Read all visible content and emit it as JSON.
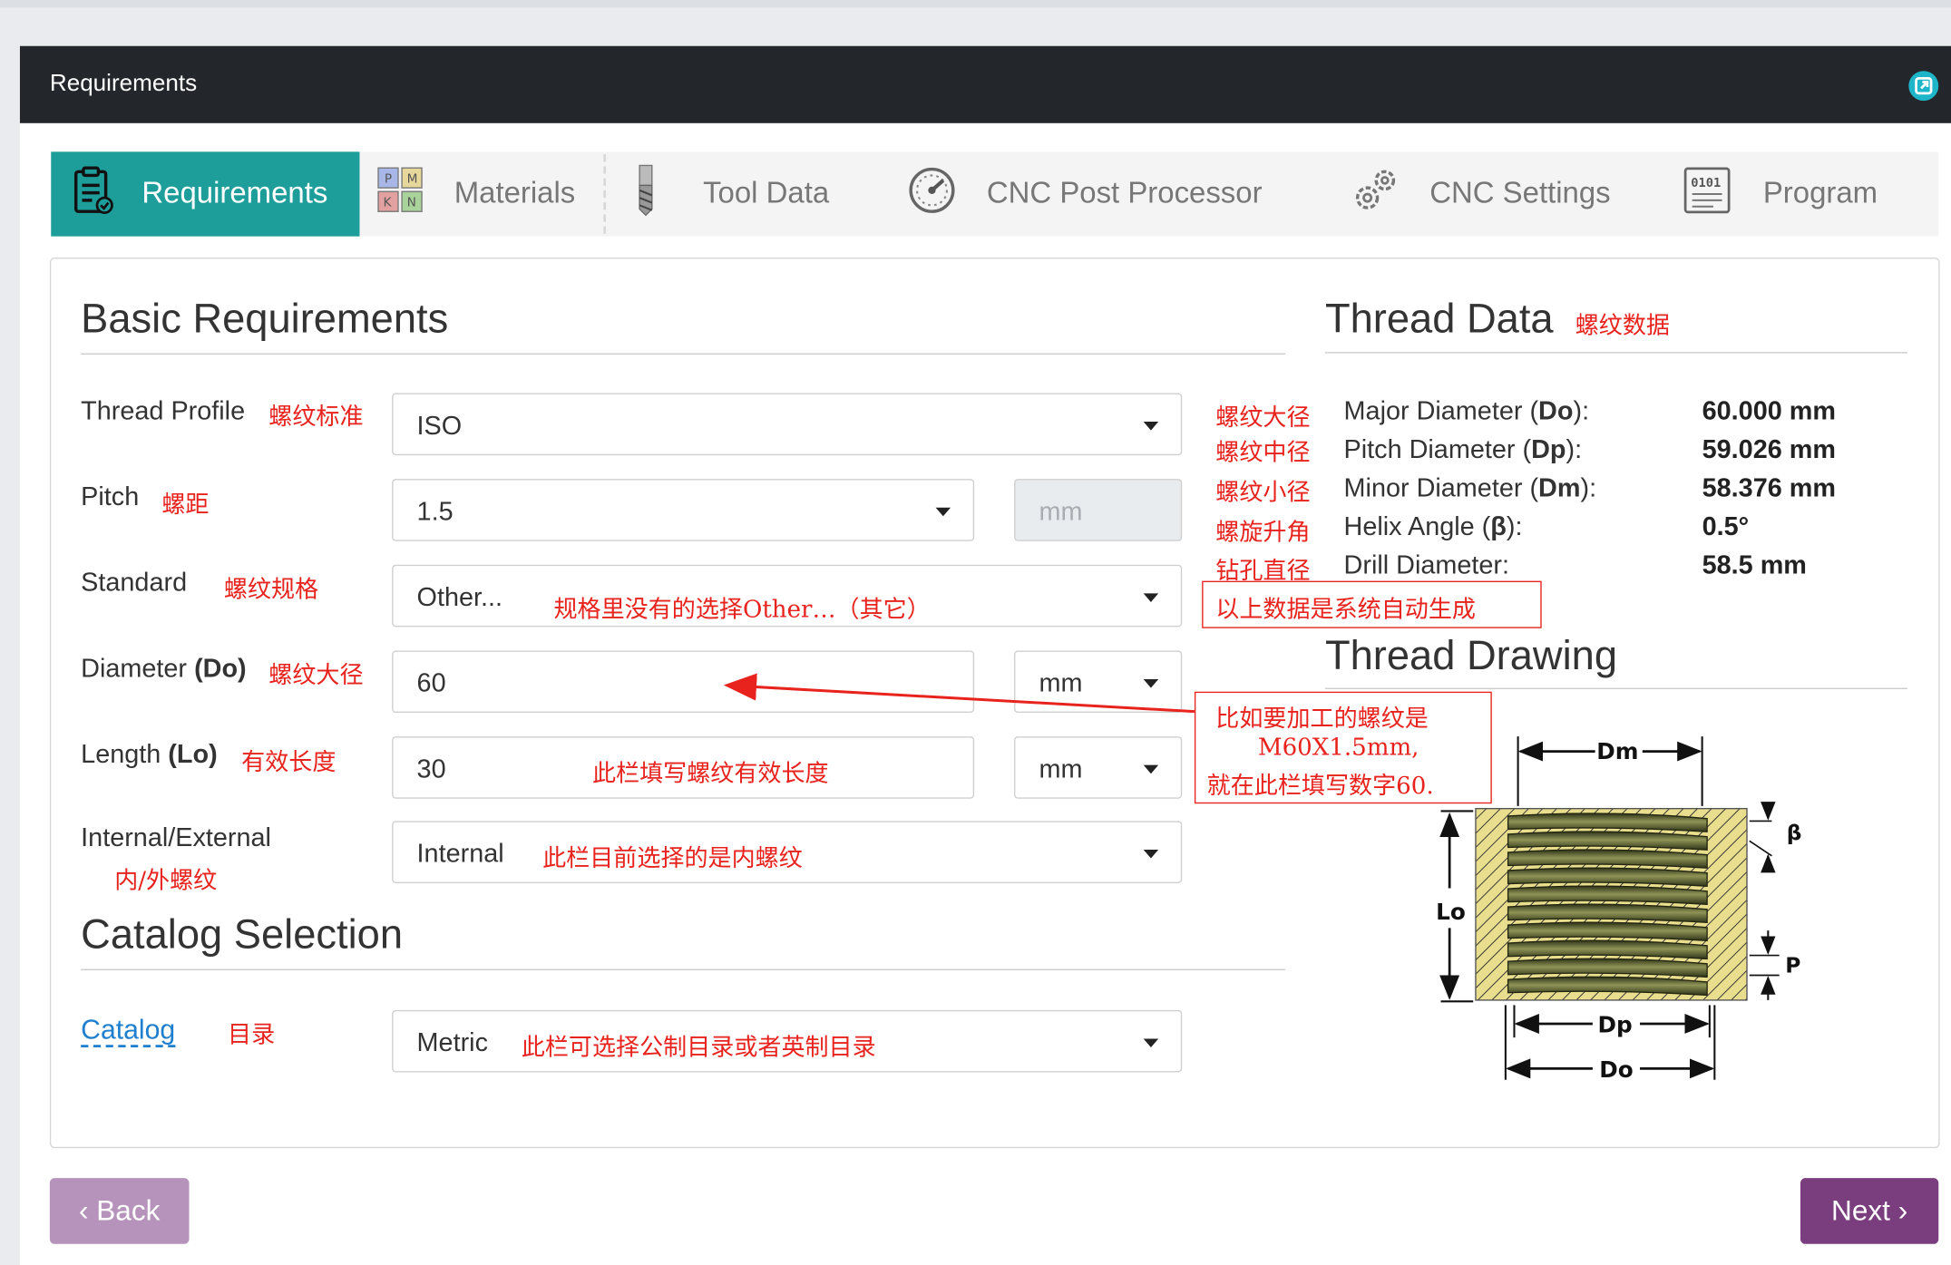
{
  "window": {
    "title": "Requirements",
    "expand_icon": "expand-icon"
  },
  "tabs": [
    {
      "label": "Requirements",
      "icon": "clipboard-icon",
      "active": true
    },
    {
      "label": "Materials",
      "icon": "materials-grid-icon",
      "active": false
    },
    {
      "label": "Tool Data",
      "icon": "end-mill-icon",
      "active": false
    },
    {
      "label": "CNC Post Processor",
      "icon": "gauge-icon",
      "active": false
    },
    {
      "label": "CNC Settings",
      "icon": "gears-icon",
      "active": false
    },
    {
      "label": "Program",
      "icon": "program-code-icon",
      "active": false
    }
  ],
  "basic": {
    "heading": "Basic Requirements",
    "thread_profile": {
      "label": "Thread Profile",
      "cn": "螺纹标准",
      "value": "ISO"
    },
    "pitch": {
      "label": "Pitch",
      "cn": "螺距",
      "value": "1.5",
      "unit": "mm"
    },
    "standard": {
      "label": "Standard",
      "cn": "螺纹规格",
      "value": "Other...",
      "note": "规格里没有的选择Other…（其它）"
    },
    "diameter": {
      "label": "Diameter",
      "label_bold": "(Do)",
      "cn": "螺纹大径",
      "value": "60",
      "unit": "mm"
    },
    "length": {
      "label": "Length",
      "label_bold": "(Lo)",
      "cn": "有效长度",
      "value": "30",
      "unit": "mm",
      "note": "此栏填写螺纹有效长度"
    },
    "int_ext": {
      "label": "Internal/External",
      "cn": "内/外螺纹",
      "value": "Internal",
      "note": "此栏目前选择的是内螺纹"
    }
  },
  "catalog": {
    "heading": "Catalog Selection",
    "label": "Catalog",
    "cn": "目录",
    "value": "Metric",
    "note": "此栏可选择公制目录或者英制目录"
  },
  "thread_data": {
    "heading": "Thread Data",
    "cn": "螺纹数据",
    "rows": [
      {
        "cn": "螺纹大径",
        "pre": "Major Diameter (",
        "sym": "Do",
        "post": "):",
        "value": "60.000 mm"
      },
      {
        "cn": "螺纹中径",
        "pre": "Pitch Diameter (",
        "sym": "Dp",
        "post": "):",
        "value": "59.026 mm"
      },
      {
        "cn": "螺纹小径",
        "pre": "Minor Diameter (",
        "sym": "Dm",
        "post": "):",
        "value": "58.376 mm"
      },
      {
        "cn": "螺旋升角",
        "pre": "Helix Angle (",
        "sym": "β",
        "post": "):",
        "value": "0.5°"
      },
      {
        "cn": "钻孔直径",
        "pre": "Drill Diameter:",
        "sym": "",
        "post": "",
        "value": "58.5 mm"
      }
    ],
    "auto_note": "以上数据是系统自动生成"
  },
  "drawing": {
    "heading": "Thread Drawing",
    "labels": {
      "dm": "Dm",
      "dp": "Dp",
      "do": "Do",
      "lo": "Lo",
      "beta": "β",
      "p": "P"
    },
    "colors": {
      "hatch_fill": "#e9dd8e",
      "hatch_line": "#333333",
      "thread_dark": "#2f3319",
      "thread_light": "#8f9456"
    }
  },
  "callout": {
    "line1": "比如要加工的螺纹是",
    "line2": "M60X1.5mm,",
    "line3": "就在此栏填写数字60."
  },
  "buttons": {
    "back": "‹ Back",
    "next": "Next ›"
  },
  "colors": {
    "accent": "#1e9e9a",
    "header_bg": "#23272b",
    "annotation": "#e8231e",
    "back_btn": "#b693bb",
    "next_btn": "#7a3d7e",
    "link": "#1f7fcf"
  }
}
